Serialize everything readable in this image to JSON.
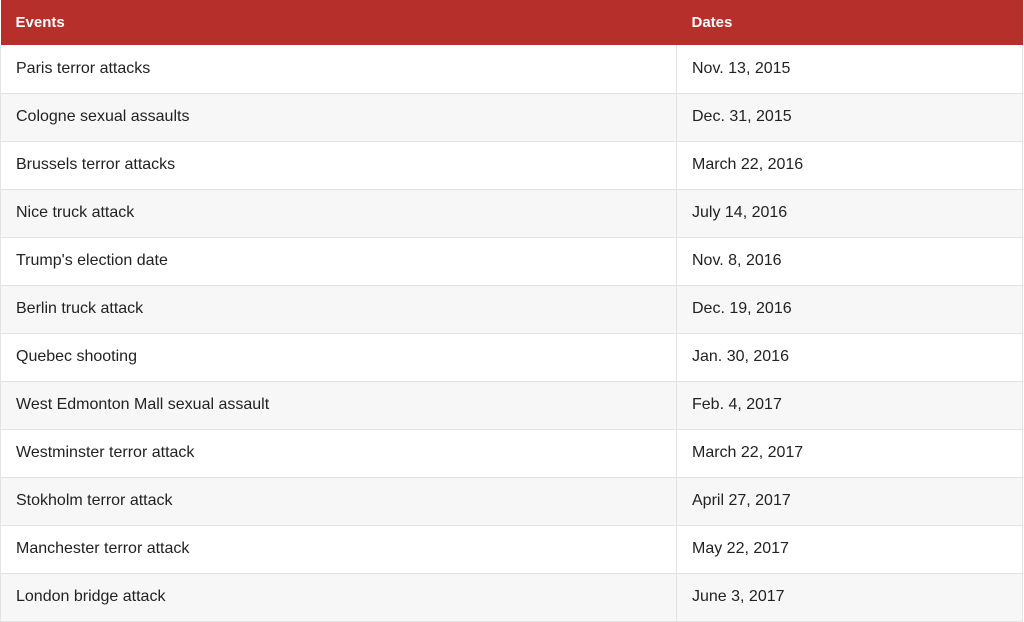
{
  "header": {
    "events": "Events",
    "dates": "Dates"
  },
  "rows": [
    {
      "event": "Paris terror attacks",
      "date": "Nov. 13, 2015"
    },
    {
      "event": "Cologne sexual assaults",
      "date": "Dec. 31, 2015"
    },
    {
      "event": "Brussels terror attacks",
      "date": "March 22, 2016"
    },
    {
      "event": "Nice truck attack",
      "date": "July 14, 2016"
    },
    {
      "event": "Trump's election date",
      "date": "Nov. 8, 2016"
    },
    {
      "event": "Berlin truck attack",
      "date": "Dec. 19, 2016"
    },
    {
      "event": "Quebec shooting",
      "date": "Jan. 30, 2016"
    },
    {
      "event": "West Edmonton Mall sexual assault",
      "date": "Feb. 4, 2017"
    },
    {
      "event": "Westminster terror attack",
      "date": "March 22, 2017"
    },
    {
      "event": "Stokholm terror attack",
      "date": "April 27, 2017"
    },
    {
      "event": "Manchester terror attack",
      "date": "May 22, 2017"
    },
    {
      "event": "London bridge attack",
      "date": "June 3, 2017"
    }
  ],
  "colors": {
    "header_bg": "#b72f2a",
    "header_text": "#ffffff",
    "row_alt_bg": "#f7f7f7",
    "border": "#e3e3e3"
  }
}
